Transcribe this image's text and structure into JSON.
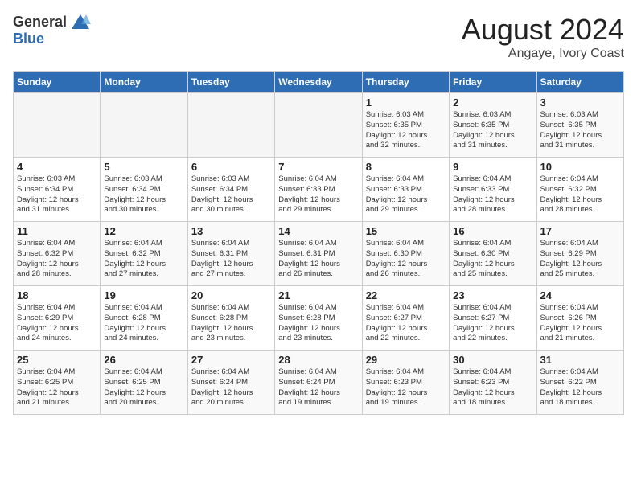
{
  "logo": {
    "general": "General",
    "blue": "Blue"
  },
  "title": {
    "month_year": "August 2024",
    "location": "Angaye, Ivory Coast"
  },
  "days_of_week": [
    "Sunday",
    "Monday",
    "Tuesday",
    "Wednesday",
    "Thursday",
    "Friday",
    "Saturday"
  ],
  "weeks": [
    [
      {
        "day": "",
        "info": ""
      },
      {
        "day": "",
        "info": ""
      },
      {
        "day": "",
        "info": ""
      },
      {
        "day": "",
        "info": ""
      },
      {
        "day": "1",
        "info": "Sunrise: 6:03 AM\nSunset: 6:35 PM\nDaylight: 12 hours\nand 32 minutes."
      },
      {
        "day": "2",
        "info": "Sunrise: 6:03 AM\nSunset: 6:35 PM\nDaylight: 12 hours\nand 31 minutes."
      },
      {
        "day": "3",
        "info": "Sunrise: 6:03 AM\nSunset: 6:35 PM\nDaylight: 12 hours\nand 31 minutes."
      }
    ],
    [
      {
        "day": "4",
        "info": "Sunrise: 6:03 AM\nSunset: 6:34 PM\nDaylight: 12 hours\nand 31 minutes."
      },
      {
        "day": "5",
        "info": "Sunrise: 6:03 AM\nSunset: 6:34 PM\nDaylight: 12 hours\nand 30 minutes."
      },
      {
        "day": "6",
        "info": "Sunrise: 6:03 AM\nSunset: 6:34 PM\nDaylight: 12 hours\nand 30 minutes."
      },
      {
        "day": "7",
        "info": "Sunrise: 6:04 AM\nSunset: 6:33 PM\nDaylight: 12 hours\nand 29 minutes."
      },
      {
        "day": "8",
        "info": "Sunrise: 6:04 AM\nSunset: 6:33 PM\nDaylight: 12 hours\nand 29 minutes."
      },
      {
        "day": "9",
        "info": "Sunrise: 6:04 AM\nSunset: 6:33 PM\nDaylight: 12 hours\nand 28 minutes."
      },
      {
        "day": "10",
        "info": "Sunrise: 6:04 AM\nSunset: 6:32 PM\nDaylight: 12 hours\nand 28 minutes."
      }
    ],
    [
      {
        "day": "11",
        "info": "Sunrise: 6:04 AM\nSunset: 6:32 PM\nDaylight: 12 hours\nand 28 minutes."
      },
      {
        "day": "12",
        "info": "Sunrise: 6:04 AM\nSunset: 6:32 PM\nDaylight: 12 hours\nand 27 minutes."
      },
      {
        "day": "13",
        "info": "Sunrise: 6:04 AM\nSunset: 6:31 PM\nDaylight: 12 hours\nand 27 minutes."
      },
      {
        "day": "14",
        "info": "Sunrise: 6:04 AM\nSunset: 6:31 PM\nDaylight: 12 hours\nand 26 minutes."
      },
      {
        "day": "15",
        "info": "Sunrise: 6:04 AM\nSunset: 6:30 PM\nDaylight: 12 hours\nand 26 minutes."
      },
      {
        "day": "16",
        "info": "Sunrise: 6:04 AM\nSunset: 6:30 PM\nDaylight: 12 hours\nand 25 minutes."
      },
      {
        "day": "17",
        "info": "Sunrise: 6:04 AM\nSunset: 6:29 PM\nDaylight: 12 hours\nand 25 minutes."
      }
    ],
    [
      {
        "day": "18",
        "info": "Sunrise: 6:04 AM\nSunset: 6:29 PM\nDaylight: 12 hours\nand 24 minutes."
      },
      {
        "day": "19",
        "info": "Sunrise: 6:04 AM\nSunset: 6:28 PM\nDaylight: 12 hours\nand 24 minutes."
      },
      {
        "day": "20",
        "info": "Sunrise: 6:04 AM\nSunset: 6:28 PM\nDaylight: 12 hours\nand 23 minutes."
      },
      {
        "day": "21",
        "info": "Sunrise: 6:04 AM\nSunset: 6:28 PM\nDaylight: 12 hours\nand 23 minutes."
      },
      {
        "day": "22",
        "info": "Sunrise: 6:04 AM\nSunset: 6:27 PM\nDaylight: 12 hours\nand 22 minutes."
      },
      {
        "day": "23",
        "info": "Sunrise: 6:04 AM\nSunset: 6:27 PM\nDaylight: 12 hours\nand 22 minutes."
      },
      {
        "day": "24",
        "info": "Sunrise: 6:04 AM\nSunset: 6:26 PM\nDaylight: 12 hours\nand 21 minutes."
      }
    ],
    [
      {
        "day": "25",
        "info": "Sunrise: 6:04 AM\nSunset: 6:25 PM\nDaylight: 12 hours\nand 21 minutes."
      },
      {
        "day": "26",
        "info": "Sunrise: 6:04 AM\nSunset: 6:25 PM\nDaylight: 12 hours\nand 20 minutes."
      },
      {
        "day": "27",
        "info": "Sunrise: 6:04 AM\nSunset: 6:24 PM\nDaylight: 12 hours\nand 20 minutes."
      },
      {
        "day": "28",
        "info": "Sunrise: 6:04 AM\nSunset: 6:24 PM\nDaylight: 12 hours\nand 19 minutes."
      },
      {
        "day": "29",
        "info": "Sunrise: 6:04 AM\nSunset: 6:23 PM\nDaylight: 12 hours\nand 19 minutes."
      },
      {
        "day": "30",
        "info": "Sunrise: 6:04 AM\nSunset: 6:23 PM\nDaylight: 12 hours\nand 18 minutes."
      },
      {
        "day": "31",
        "info": "Sunrise: 6:04 AM\nSunset: 6:22 PM\nDaylight: 12 hours\nand 18 minutes."
      }
    ]
  ]
}
